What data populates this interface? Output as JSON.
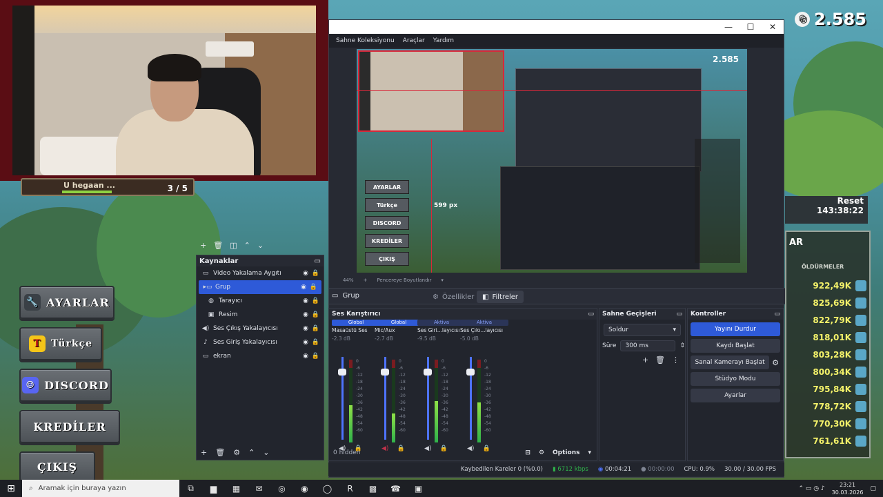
{
  "colors": {
    "obs_bg": "#272a33",
    "obs_accent": "#2e5ad8",
    "webcam_frame": "#5a0d14",
    "leaderboard_value": "#f4f26a"
  },
  "game": {
    "buttons": [
      {
        "label": "AYARLAR",
        "icon": "wrench-icon"
      },
      {
        "label": "Türkçe",
        "icon": "language-icon"
      },
      {
        "label": "DISCORD",
        "icon": "discord-icon"
      },
      {
        "label": "KREDİLER",
        "icon": ""
      },
      {
        "label": "ÇIKIŞ",
        "icon": ""
      }
    ],
    "quest": {
      "text": "U hegaan ...",
      "progress_text": "3 / 5",
      "progress": 0.6
    },
    "counter": "2.585",
    "reset": {
      "label": "Reset",
      "time": "143:38:22"
    },
    "leaderboard": {
      "title": "AR",
      "column": "ÖLDÜRMELER",
      "rows": [
        "922,49K",
        "825,69K",
        "822,79K",
        "818,01K",
        "803,28K",
        "800,34K",
        "795,84K",
        "778,72K",
        "770,30K",
        "761,61K"
      ],
      "side_labels": [
        "",
        "",
        "",
        "y",
        "",
        "",
        ":)",
        "",
        "",
        ""
      ]
    }
  },
  "obs": {
    "menu": [
      "Sahne Koleksiyonu",
      "Araçlar",
      "Yardım"
    ],
    "window_controls": [
      "—",
      "☐",
      "✕"
    ],
    "preview": {
      "counter": "2.585",
      "px_label": "599 px",
      "buttons": [
        "AYARLAR",
        "Türkçe",
        "DISCORD",
        "KREDİLER",
        "ÇIKIŞ"
      ]
    },
    "zoom": [
      "44%",
      "+",
      "Pencereye Boyutlandır",
      "▾"
    ],
    "context": {
      "name": "Grup",
      "tab_properties": "Özellikler",
      "tab_filters": "Filtreler"
    },
    "sources": {
      "title": "Kaynaklar",
      "items": [
        {
          "label": "Video Yakalama Aygıtı",
          "icon": "camera-icon",
          "selected": false
        },
        {
          "label": "Grup",
          "icon": "folder-icon",
          "selected": true
        },
        {
          "label": "Tarayıcı",
          "icon": "globe-icon",
          "selected": false
        },
        {
          "label": "Resim",
          "icon": "image-icon",
          "selected": false
        },
        {
          "label": "Ses Çıkış Yakalayıcısı",
          "icon": "speaker-icon",
          "selected": false
        },
        {
          "label": "Ses Giriş Yakalayıcısı",
          "icon": "mic-icon",
          "selected": false
        },
        {
          "label": "ekran",
          "icon": "monitor-icon",
          "selected": false
        }
      ]
    },
    "mixer": {
      "title": "Ses Karıştırıcı",
      "channels": [
        {
          "badge": "Global",
          "name": "Masaüstü Ses",
          "db": "-2.3 dB",
          "level": 0.45,
          "fader": 0.85,
          "muted": false
        },
        {
          "badge": "Global",
          "name": "Mic/Aux",
          "db": "-2.7 dB",
          "level": 0.35,
          "fader": 0.85,
          "muted": true
        },
        {
          "badge": "Aktiva",
          "name": "Ses Giri...layıcısı",
          "db": "-9.5 dB",
          "level": 0.5,
          "fader": 0.85,
          "muted": false
        },
        {
          "badge": "Aktiva",
          "name": "Ses Çıkı...layıcısı",
          "db": "-5.0 dB",
          "level": 0.48,
          "fader": 0.85,
          "muted": false
        }
      ],
      "scale": [
        "0",
        "-6",
        "-12",
        "-18",
        "-24",
        "-30",
        "-36",
        "-42",
        "-48",
        "-54",
        "-60"
      ],
      "hidden": "0 hidden",
      "options": "Options"
    },
    "transitions": {
      "title": "Sahne Geçişleri",
      "selected": "Soldur",
      "duration_label": "Süre",
      "duration": "300 ms"
    },
    "controls": {
      "title": "Kontroller",
      "stop_stream": "Yayını Durdur",
      "start_record": "Kaydı Başlat",
      "virtual_cam": "Sanal Kamerayı Başlat",
      "studio_mode": "Stüdyo Modu",
      "settings": "Ayarlar"
    },
    "status": {
      "dropped": "Kaybedilen Kareler 0 (%0.0)",
      "bitrate": "6712 kbps",
      "stream_time": "00:04:21",
      "record_time": "00:00:00",
      "cpu": "CPU: 0.9%",
      "fps": "30.00 / 30.00 FPS"
    }
  },
  "taskbar": {
    "search_placeholder": "Aramak için buraya yazın",
    "time": "23:21",
    "date": "30.03.2026"
  }
}
